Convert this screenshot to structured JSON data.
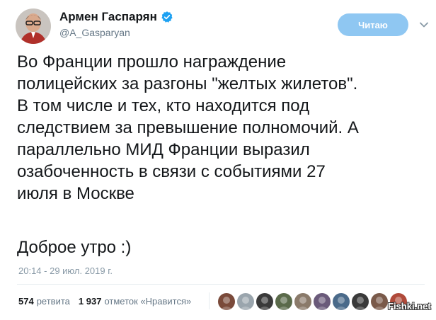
{
  "author": {
    "display_name": "Армен Гаспарян",
    "handle": "@A_Gasparyan",
    "verified": true
  },
  "follow_button": {
    "label": "Читаю"
  },
  "tweet": {
    "text": "Во Франции прошло награждение\nполицейских за разгоны \"желтых жилетов\".\nВ том числе и тех, кто находится под\nследствием за превышение полномочий. А\nпараллельно МИД Франции выразил\nозабоченность в связи с событиями 27\nиюля в Москве",
    "greeting": "Доброе утро :)",
    "timestamp": "20:14 - 29 июл. 2019 г."
  },
  "stats": {
    "retweets_count": "574",
    "retweets_label": "ретвита",
    "likes_count": "1 937",
    "likes_label": "отметок «Нравится»"
  },
  "liker_avatars": [
    "#7a4a3a",
    "#9aa5ad",
    "#3a3a3a",
    "#5a6a4a",
    "#8a7a6a",
    "#6a5a7a",
    "#4a6a8a",
    "#3a3a3a",
    "#7a5a4a",
    "#b04a3a"
  ],
  "colors": {
    "accent": "#1da1f2",
    "follow_bg": "#8fc7f2",
    "secondary_text": "#657786",
    "timestamp_text": "#8899a6"
  },
  "icons": {
    "verified": "verified-badge-icon",
    "caret": "chevron-down-icon"
  },
  "watermark": "Fishki.net"
}
